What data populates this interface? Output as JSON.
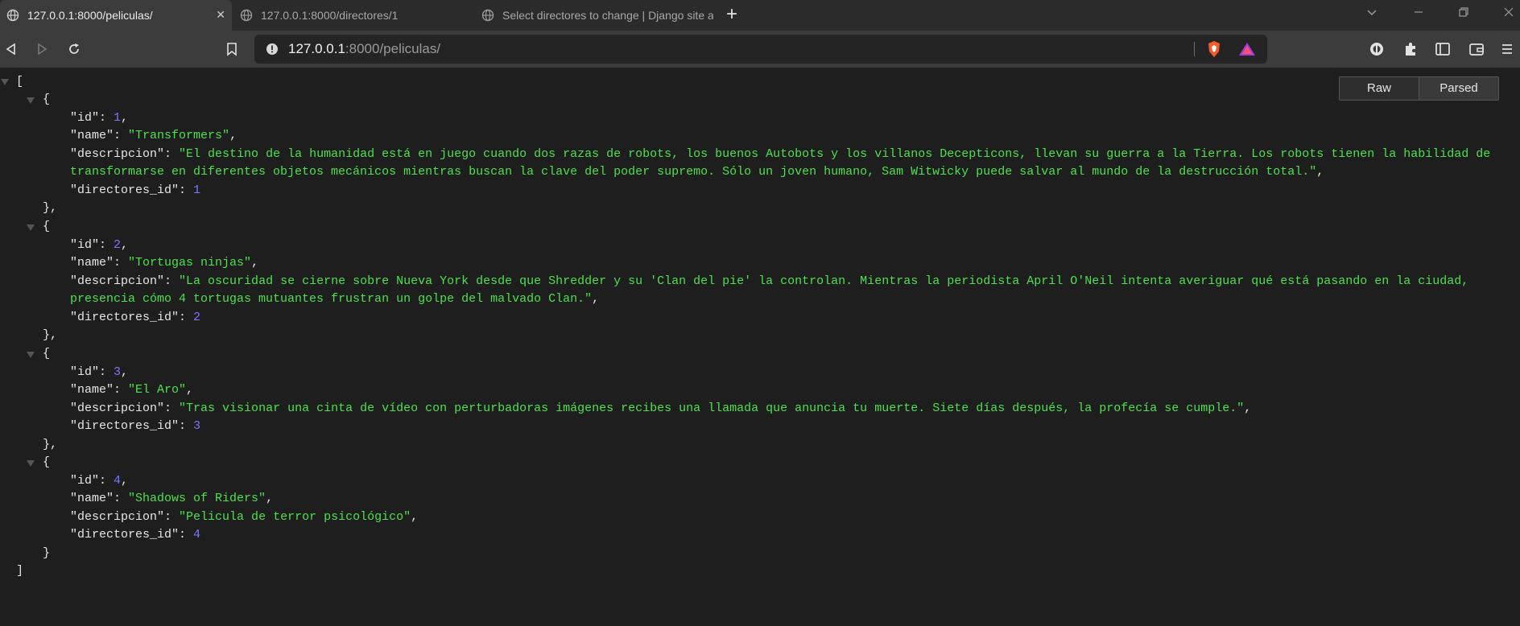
{
  "tabs": [
    {
      "title": "127.0.0.1:8000/peliculas/",
      "active": true
    },
    {
      "title": "127.0.0.1:8000/directores/1",
      "active": false
    },
    {
      "title": "Select directores to change | Django site admin",
      "active": false
    }
  ],
  "address": {
    "host": "127.0.0.1",
    "rest": ":8000/peliculas/"
  },
  "viewer": {
    "raw_label": "Raw",
    "parsed_label": "Parsed"
  },
  "json": {
    "open_bracket": "[",
    "close_bracket": "]",
    "items": [
      {
        "id": "1",
        "name": "\"Transformers\"",
        "descripcion_line1": "\"El destino de la humanidad está en juego cuando dos razas de robots, los buenos Autobots y los villanos Decepticons, llevan su guerra a la Tierra. Los robots tienen la habilidad de",
        "descripcion_line2": "transformarse en diferentes objetos mecánicos mientras buscan la clave del poder supremo. Sólo un joven humano, Sam Witwicky puede salvar al mundo de la destrucción total.\"",
        "directores_id": "1"
      },
      {
        "id": "2",
        "name": "\"Tortugas ninjas\"",
        "descripcion_line1": "\"La oscuridad se cierne sobre Nueva York desde que Shredder y su 'Clan del pie' la controlan. Mientras la periodista April O'Neil intenta averiguar qué está pasando en la ciudad,",
        "descripcion_line2": "presencia cómo 4 tortugas mutuantes frustran un golpe del malvado Clan.\"",
        "directores_id": "2"
      },
      {
        "id": "3",
        "name": "\"El Aro\"",
        "descripcion_line1": "\"Tras visionar una cinta de vídeo con perturbadoras imágenes recibes una llamada que anuncia tu muerte. Siete días después, la profecía se cumple.\"",
        "directores_id": "3"
      },
      {
        "id": "4",
        "name": "\"Shadows of Riders\"",
        "descripcion_line1": "\"Pelicula de terror psicológico\"",
        "directores_id": "4"
      }
    ]
  },
  "keys": {
    "id": "\"id\"",
    "name": "\"name\"",
    "descripcion": "\"descripcion\"",
    "directores_id": "\"directores_id\""
  },
  "icons": [
    "globe-icon",
    "close-icon",
    "plus-icon",
    "back-icon",
    "forward-icon",
    "reload-icon",
    "bookmark-icon",
    "info-icon",
    "brave-shield-icon",
    "brave-rewards-icon",
    "extensions-icon",
    "sidebar-icon",
    "wallet-icon",
    "menu-icon"
  ]
}
